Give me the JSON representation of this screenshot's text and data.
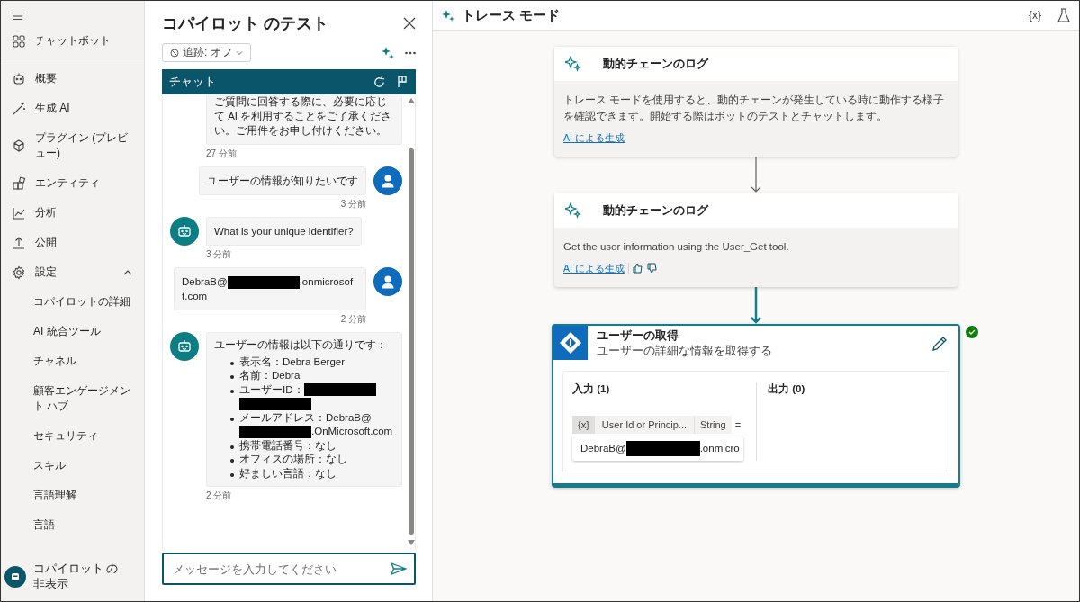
{
  "sidebar": {
    "items": [
      {
        "label": "チャットボット"
      },
      {
        "label": "概要"
      },
      {
        "label": "生成 AI"
      },
      {
        "label": "プラグイン (プレビュー)"
      },
      {
        "label": "エンティティ"
      },
      {
        "label": "分析"
      },
      {
        "label": "公開"
      },
      {
        "label": "設定",
        "expanded": true,
        "children": [
          {
            "label": "コパイロットの詳細"
          },
          {
            "label": "AI 統合ツール"
          },
          {
            "label": "チャネル"
          },
          {
            "label": "顧客エンゲージメント ハブ"
          },
          {
            "label": "セキュリティ"
          },
          {
            "label": "スキル"
          },
          {
            "label": "言語理解"
          },
          {
            "label": "言語"
          }
        ]
      }
    ],
    "footer": {
      "label": "コパイロット の非表示"
    }
  },
  "chat_panel": {
    "title": "コパイロット のテスト",
    "tracking": "追跡: オフ",
    "header": "チャット",
    "messages": [
      {
        "kind": "bot",
        "cut_off": true,
        "segments": [
          {
            "text": "ご質問に回答する際に、必要に応じて AI を利用することをご了承ください。ご用件をお申し付けください。"
          }
        ],
        "time": "27 分前"
      },
      {
        "kind": "user",
        "cut_off": false,
        "segments": [
          {
            "text": "ユーザーの情報が知りたいです"
          }
        ],
        "time": "3 分前"
      },
      {
        "kind": "bot",
        "cut_off": false,
        "segments": [
          {
            "text": "What is your unique identifier?"
          }
        ],
        "time": "3 分前"
      },
      {
        "kind": "user",
        "cut_off": false,
        "segments": [
          {
            "text": "DebraB@"
          },
          {
            "kind": "redacted"
          },
          {
            "text": ".onmicrosoft.com"
          }
        ],
        "time": "2 分前"
      },
      {
        "kind": "bot",
        "cut_off": false,
        "segments": [
          {
            "text": "ユーザーの情報は以下の通りです："
          }
        ],
        "bullets": [
          [
            {
              "text": "表示名：Debra Berger"
            }
          ],
          [
            {
              "text": "名前：Debra"
            }
          ],
          [
            {
              "text": "ユーザーID："
            },
            {
              "kind": "redacted"
            },
            {
              "kind": "redacted"
            }
          ],
          [
            {
              "text": "メールアドレス：DebraB@"
            },
            {
              "kind": "redacted"
            },
            {
              "text": ".OnMicrosoft.com"
            }
          ],
          [
            {
              "text": "携帯電話番号：なし"
            }
          ],
          [
            {
              "text": "オフィスの場所：なし"
            }
          ],
          [
            {
              "text": "好ましい言語：なし"
            }
          ]
        ],
        "time": "2 分前"
      }
    ],
    "input": {
      "placeholder": "メッセージを入力してください"
    }
  },
  "trace": {
    "title": "トレース モード",
    "variables_button": "{x}",
    "steps": [
      {
        "kind": "log",
        "title": "動的チェーンのログ",
        "text": "トレース モードを使用すると、動的チェーンが発生している時に動作する様子を確認できます。開始する際はボットのテストとチャットします。",
        "link": "AI による生成",
        "feedback": false,
        "selected": false
      },
      {
        "kind": "log",
        "title": "動的チェーンのログ",
        "text": "Get the user information using the User_Get tool.",
        "link": "AI による生成",
        "feedback": true,
        "selected": false
      },
      {
        "kind": "tool",
        "title": "ユーザーの取得",
        "subtitle": "ユーザーの詳細な情報を取得する",
        "succeeded": true,
        "selected": true,
        "inputs_label": "入力 (1)",
        "outputs_label": "出力 (0)",
        "inputs": [
          {
            "badge": "{x}",
            "name": "User Id or Princip...",
            "type": "String",
            "operator": "=",
            "value": [
              {
                "text": "DebraB@"
              },
              {
                "kind": "redacted"
              },
              {
                "text": ".onmicro"
              }
            ]
          }
        ]
      }
    ]
  }
}
